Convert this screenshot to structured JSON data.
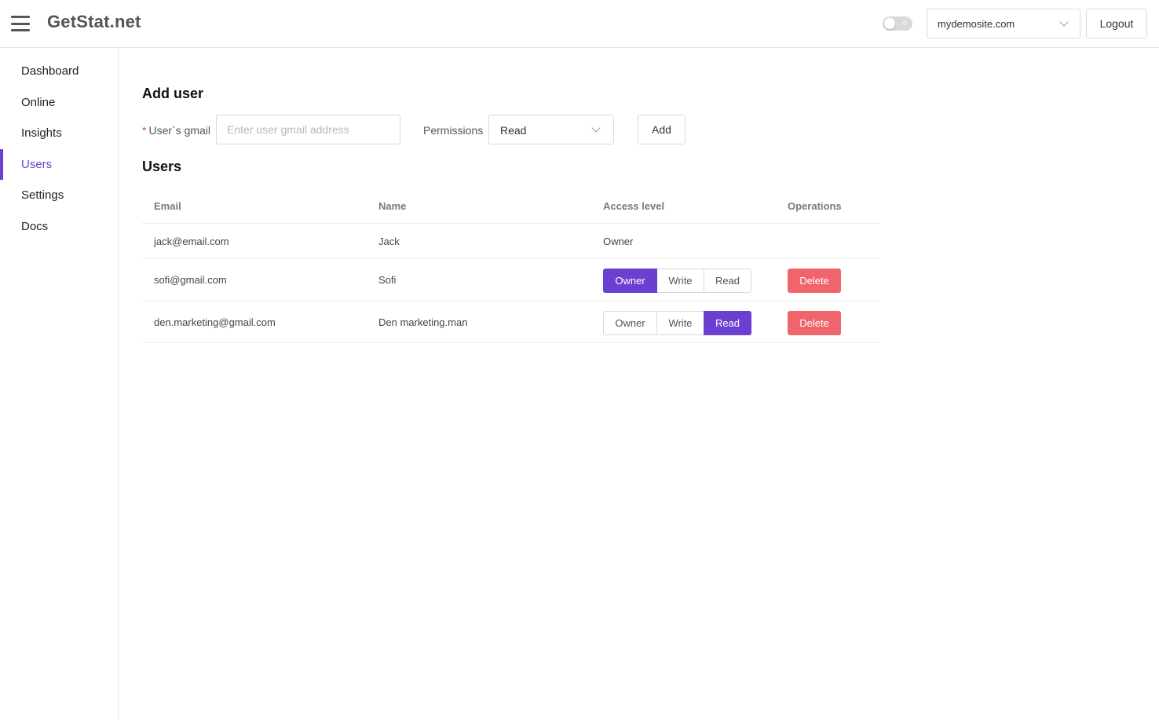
{
  "header": {
    "brand": "GetStat.net",
    "toggle_text": "o",
    "site_selected": "mydemosite.com",
    "logout_label": "Logout"
  },
  "sidebar": {
    "items": [
      {
        "label": "Dashboard",
        "active": false
      },
      {
        "label": "Online",
        "active": false
      },
      {
        "label": "Insights",
        "active": false
      },
      {
        "label": "Users",
        "active": true
      },
      {
        "label": "Settings",
        "active": false
      },
      {
        "label": "Docs",
        "active": false
      }
    ]
  },
  "add_user": {
    "title": "Add user",
    "required_mark": "*",
    "email_label": "User`s gmail",
    "email_value": "",
    "email_placeholder": "Enter user gmail address",
    "permissions_label": "Permissions",
    "permissions_selected": "Read",
    "add_label": "Add"
  },
  "users": {
    "title": "Users",
    "columns": [
      "Email",
      "Name",
      "Access level",
      "Operations"
    ],
    "access_options": [
      "Owner",
      "Write",
      "Read"
    ],
    "delete_label": "Delete",
    "rows": [
      {
        "email": "jack@email.com",
        "name": "Jack",
        "access": "Owner",
        "editable": false
      },
      {
        "email": "sofi@gmail.com",
        "name": "Sofi",
        "access": "Owner",
        "editable": true
      },
      {
        "email": "den.marketing@gmail.com",
        "name": "Den marketing.man",
        "access": "Read",
        "editable": true
      }
    ]
  },
  "colors": {
    "accent": "#6b3fd0",
    "danger": "#f0646b"
  }
}
